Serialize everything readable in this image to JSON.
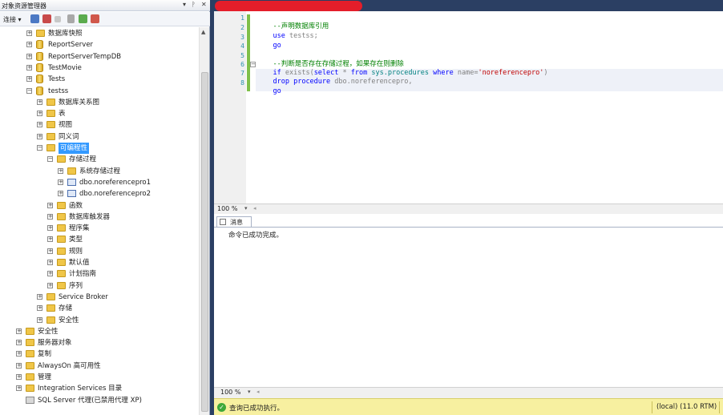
{
  "object_explorer": {
    "title": "对象资源管理器",
    "pin_glyph": "▾ ᚹ ✕",
    "toolbar": {
      "connect_label": "连接 ▾"
    },
    "tree": [
      {
        "label": "数据库快照",
        "level": 2,
        "icon": "folder-icon",
        "expander": "+"
      },
      {
        "label": "ReportServer",
        "level": 2,
        "icon": "database-icon",
        "expander": "+"
      },
      {
        "label": "ReportServerTempDB",
        "level": 2,
        "icon": "database-icon",
        "expander": "+"
      },
      {
        "label": "TestMovie",
        "level": 2,
        "icon": "database-icon",
        "expander": "+"
      },
      {
        "label": "Tests",
        "level": 2,
        "icon": "database-icon",
        "expander": "+"
      },
      {
        "label": "testss",
        "level": 2,
        "icon": "database-icon",
        "expander": "−"
      },
      {
        "label": "数据库关系图",
        "level": 3,
        "icon": "folder-icon",
        "expander": "+"
      },
      {
        "label": "表",
        "level": 3,
        "icon": "folder-icon",
        "expander": "+"
      },
      {
        "label": "视图",
        "level": 3,
        "icon": "folder-icon",
        "expander": "+"
      },
      {
        "label": "同义词",
        "level": 3,
        "icon": "folder-icon",
        "expander": "+"
      },
      {
        "label": "可编程性",
        "level": 3,
        "icon": "folder-icon",
        "expander": "−",
        "selected": true
      },
      {
        "label": "存储过程",
        "level": 4,
        "icon": "folder-icon",
        "expander": "−"
      },
      {
        "label": "系统存储过程",
        "level": 5,
        "icon": "folder-icon",
        "expander": "+"
      },
      {
        "label": "dbo.noreferencepro1",
        "level": 5,
        "icon": "procedure-icon",
        "expander": "+"
      },
      {
        "label": "dbo.noreferencepro2",
        "level": 5,
        "icon": "procedure-icon",
        "expander": "+"
      },
      {
        "label": "函数",
        "level": 4,
        "icon": "folder-icon",
        "expander": "+"
      },
      {
        "label": "数据库触发器",
        "level": 4,
        "icon": "folder-icon",
        "expander": "+"
      },
      {
        "label": "程序集",
        "level": 4,
        "icon": "folder-icon",
        "expander": "+"
      },
      {
        "label": "类型",
        "level": 4,
        "icon": "folder-icon",
        "expander": "+"
      },
      {
        "label": "规则",
        "level": 4,
        "icon": "folder-icon",
        "expander": "+"
      },
      {
        "label": "默认值",
        "level": 4,
        "icon": "folder-icon",
        "expander": "+"
      },
      {
        "label": "计划指南",
        "level": 4,
        "icon": "folder-icon",
        "expander": "+"
      },
      {
        "label": "序列",
        "level": 4,
        "icon": "folder-icon",
        "expander": "+"
      },
      {
        "label": "Service Broker",
        "level": 3,
        "icon": "folder-icon",
        "expander": "+"
      },
      {
        "label": "存储",
        "level": 3,
        "icon": "folder-icon",
        "expander": "+"
      },
      {
        "label": "安全性",
        "level": 3,
        "icon": "folder-icon",
        "expander": "+"
      },
      {
        "label": "安全性",
        "level": 1,
        "icon": "folder-icon",
        "expander": "+"
      },
      {
        "label": "服务器对象",
        "level": 1,
        "icon": "folder-icon",
        "expander": "+"
      },
      {
        "label": "复制",
        "level": 1,
        "icon": "folder-icon",
        "expander": "+"
      },
      {
        "label": "AlwaysOn 高可用性",
        "level": 1,
        "icon": "folder-icon",
        "expander": "+"
      },
      {
        "label": "管理",
        "level": 1,
        "icon": "folder-icon",
        "expander": "+"
      },
      {
        "label": "Integration Services 目录",
        "level": 1,
        "icon": "folder-icon",
        "expander": "+"
      },
      {
        "label": "SQL Server 代理(已禁用代理 XP)",
        "level": 1,
        "icon": "agent-icon",
        "expander": ""
      }
    ]
  },
  "editor": {
    "line_numbers": [
      "1",
      "2",
      "3",
      "4",
      "5",
      "6",
      "7",
      "8"
    ],
    "fold_glyph": "−",
    "code": {
      "l1_comment": "--声明数据库引用",
      "l2_kw": "use",
      "l2_tx": " testss;",
      "l3_kw": "go",
      "l5_comment": "--判断是否存在存储过程，如果存在则删除",
      "l6_if": "if",
      "l6_exists": " exists",
      "l6_paren": "(",
      "l6_select": "select",
      "l6_star": " * ",
      "l6_from": "from",
      "l6_sys": " sys.procedures ",
      "l6_where": "where",
      "l6_name": " name",
      "l6_eq": "=",
      "l6_str": "'noreferencepro'",
      "l6_close": ")",
      "l7_drop": "drop",
      "l7_proc": " procedure",
      "l7_obj": " dbo.noreferencepro,",
      "l8_kw": "go"
    }
  },
  "editor_zoom": {
    "value": "100 %",
    "dropdown": "▾",
    "arrow": "◂"
  },
  "results": {
    "tab_label": "消息",
    "message": "命令已成功完成。"
  },
  "results_zoom": {
    "value": "100 %",
    "dropdown": "▾",
    "arrow": "◂"
  },
  "status_bar": {
    "icon_glyph": "✓",
    "message": "查询已成功执行。",
    "server": "(local) (11.0 RTM)"
  },
  "colors": {
    "chrome_dark": "#2b3f63",
    "status_yellow": "#f7f0a0",
    "selection": "#3399ff",
    "comment_green": "#008000",
    "keyword_blue": "#0000ff",
    "string_red": "#c00000",
    "redaction_red": "#e41e2a"
  }
}
